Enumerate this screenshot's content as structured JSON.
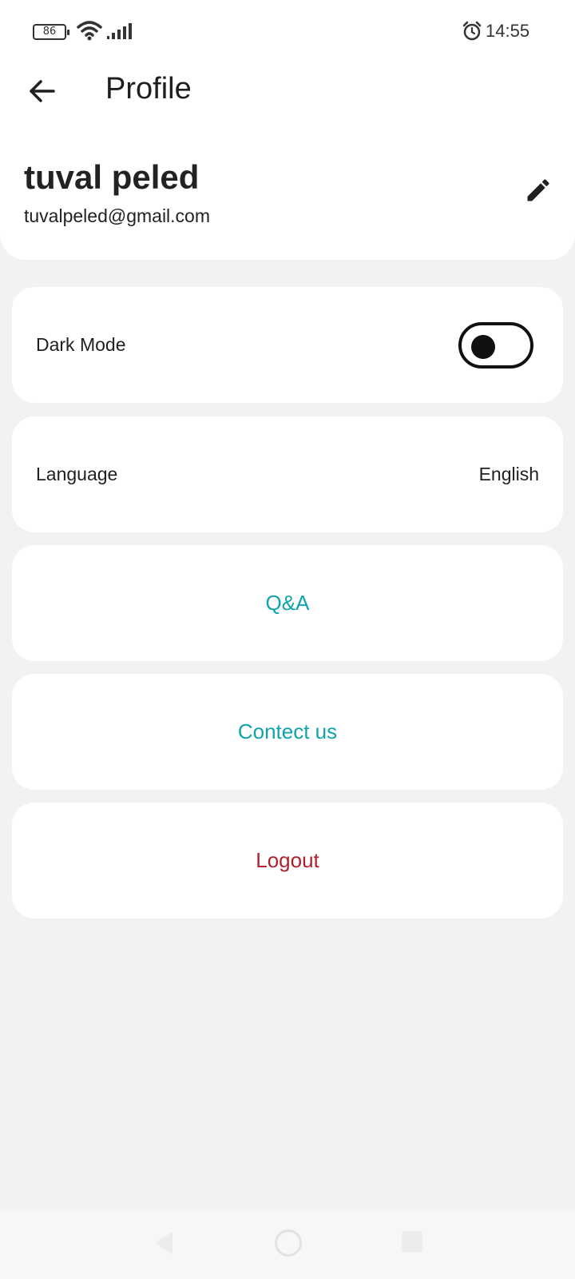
{
  "status_bar": {
    "battery": "86",
    "time": "14:55",
    "icons": [
      "battery-icon",
      "wifi-icon",
      "signal-icon",
      "alarm-icon"
    ]
  },
  "header": {
    "title": "Profile",
    "back_icon": "arrow-left-icon",
    "edit_icon": "pencil-icon"
  },
  "user": {
    "name": "tuval peled",
    "email": "tuvalpeled@gmail.com"
  },
  "settings": {
    "dark_mode": {
      "label": "Dark Mode",
      "enabled": false
    },
    "language": {
      "label": "Language",
      "value": "English"
    }
  },
  "actions": {
    "qa": {
      "label": "Q&A",
      "color": "#0fa3ac"
    },
    "contact": {
      "label": "Contect us",
      "color": "#0fa3ac"
    },
    "logout": {
      "label": "Logout",
      "color": "#b21f2d"
    }
  },
  "colors": {
    "background": "#f2f2f2",
    "card": "#ffffff",
    "accent": "#0fa3ac",
    "danger": "#b21f2d"
  },
  "nav_bar": {
    "icons": [
      "nav-back-icon",
      "nav-home-icon",
      "nav-recent-icon"
    ]
  }
}
